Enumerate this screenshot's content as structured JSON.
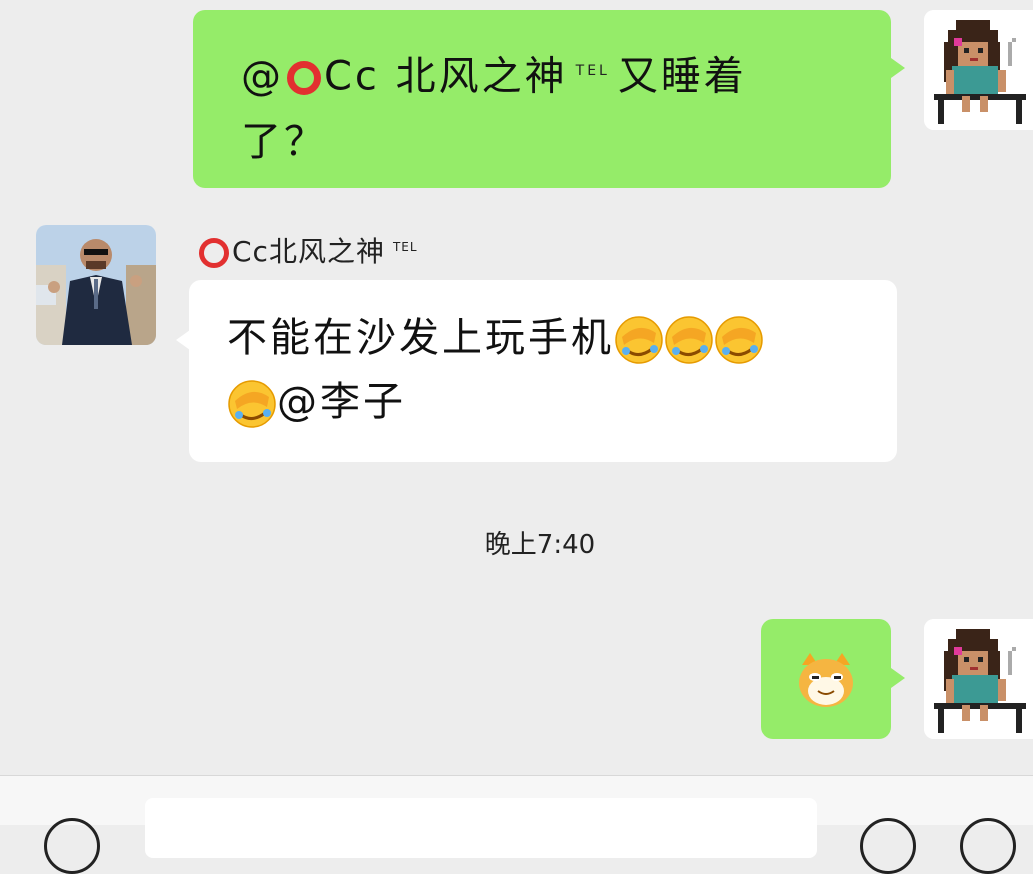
{
  "messages": {
    "first": {
      "mention_prefix": "@",
      "mention_name": "Cc 北风之神",
      "tel_badge": "TEL",
      "text_line1": "又睡着",
      "text_line2": "了？"
    },
    "second": {
      "sender_name": "Cc北风之神",
      "tel_badge": "TEL",
      "text_line1": "不能在沙发上玩手机",
      "text_line2": "@李子",
      "emoji": "facepalm-laugh-emoji"
    },
    "third": {
      "sticker": "doge-cat-sticker"
    }
  },
  "timestamp": "晚上7:40",
  "colors": {
    "own_bubble": "#95ec69",
    "other_bubble": "#ffffff",
    "background": "#ededed",
    "ring": "#e23030"
  }
}
